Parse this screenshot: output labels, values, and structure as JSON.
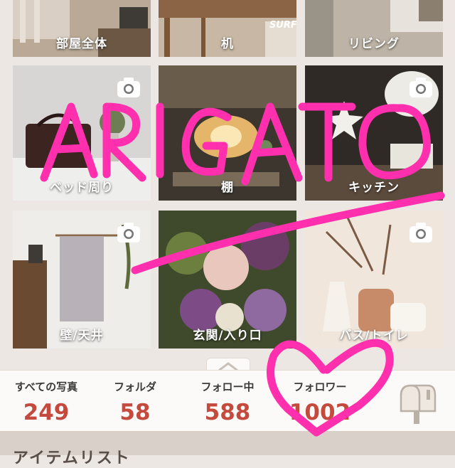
{
  "categories": [
    {
      "label": "部屋全体",
      "camera": false
    },
    {
      "label": "机",
      "camera": false
    },
    {
      "label": "リビング",
      "camera": false
    },
    {
      "label": "ベッド周り",
      "camera": true
    },
    {
      "label": "棚",
      "camera": false
    },
    {
      "label": "キッチン",
      "camera": true
    },
    {
      "label": "壁/天井",
      "camera": true
    },
    {
      "label": "玄関/入り口",
      "camera": false
    },
    {
      "label": "バス/トイレ",
      "camera": true
    }
  ],
  "decor_text": "SURF",
  "stats": [
    {
      "label": "すべての写真",
      "value": "249"
    },
    {
      "label": "フォルダ",
      "value": "58"
    },
    {
      "label": "フォロー中",
      "value": "588"
    },
    {
      "label": "フォロワー",
      "value": "1002"
    }
  ],
  "bottom_section": {
    "title": "アイテムリスト"
  },
  "handwriting": {
    "text": "ARIGATO",
    "color": "#ff2fae"
  },
  "colors": {
    "stat_number": "#c44a3e",
    "background": "#ece7e2"
  }
}
